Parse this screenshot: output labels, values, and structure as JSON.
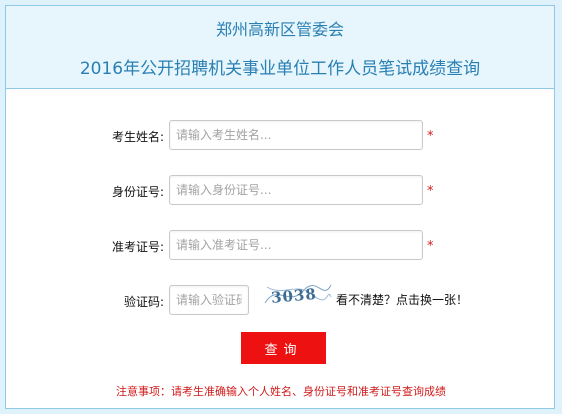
{
  "header": {
    "line1": "郑州高新区管委会",
    "line2": "2016年公开招聘机关事业单位工作人员笔试成绩查询"
  },
  "form": {
    "name_label": "考生姓名:",
    "name_placeholder": "请输入考生姓名...",
    "id_label": "身份证号:",
    "id_placeholder": "请输入身份证号...",
    "ticket_label": "准考证号:",
    "ticket_placeholder": "请输入准考证号...",
    "captcha_label": "验证码:",
    "captcha_placeholder": "请输入验证码",
    "captcha_text": "3038",
    "refresh_text": "看不清楚？点击换一张！",
    "required_mark": "*",
    "submit_label": "查询"
  },
  "notice": "注意事项：请考生准确输入个人姓名、身份证号和准考证号查询成绩",
  "colors": {
    "header_text": "#2a7fb3",
    "accent_red": "#ee1111",
    "page_bg": "#dff2fb"
  }
}
